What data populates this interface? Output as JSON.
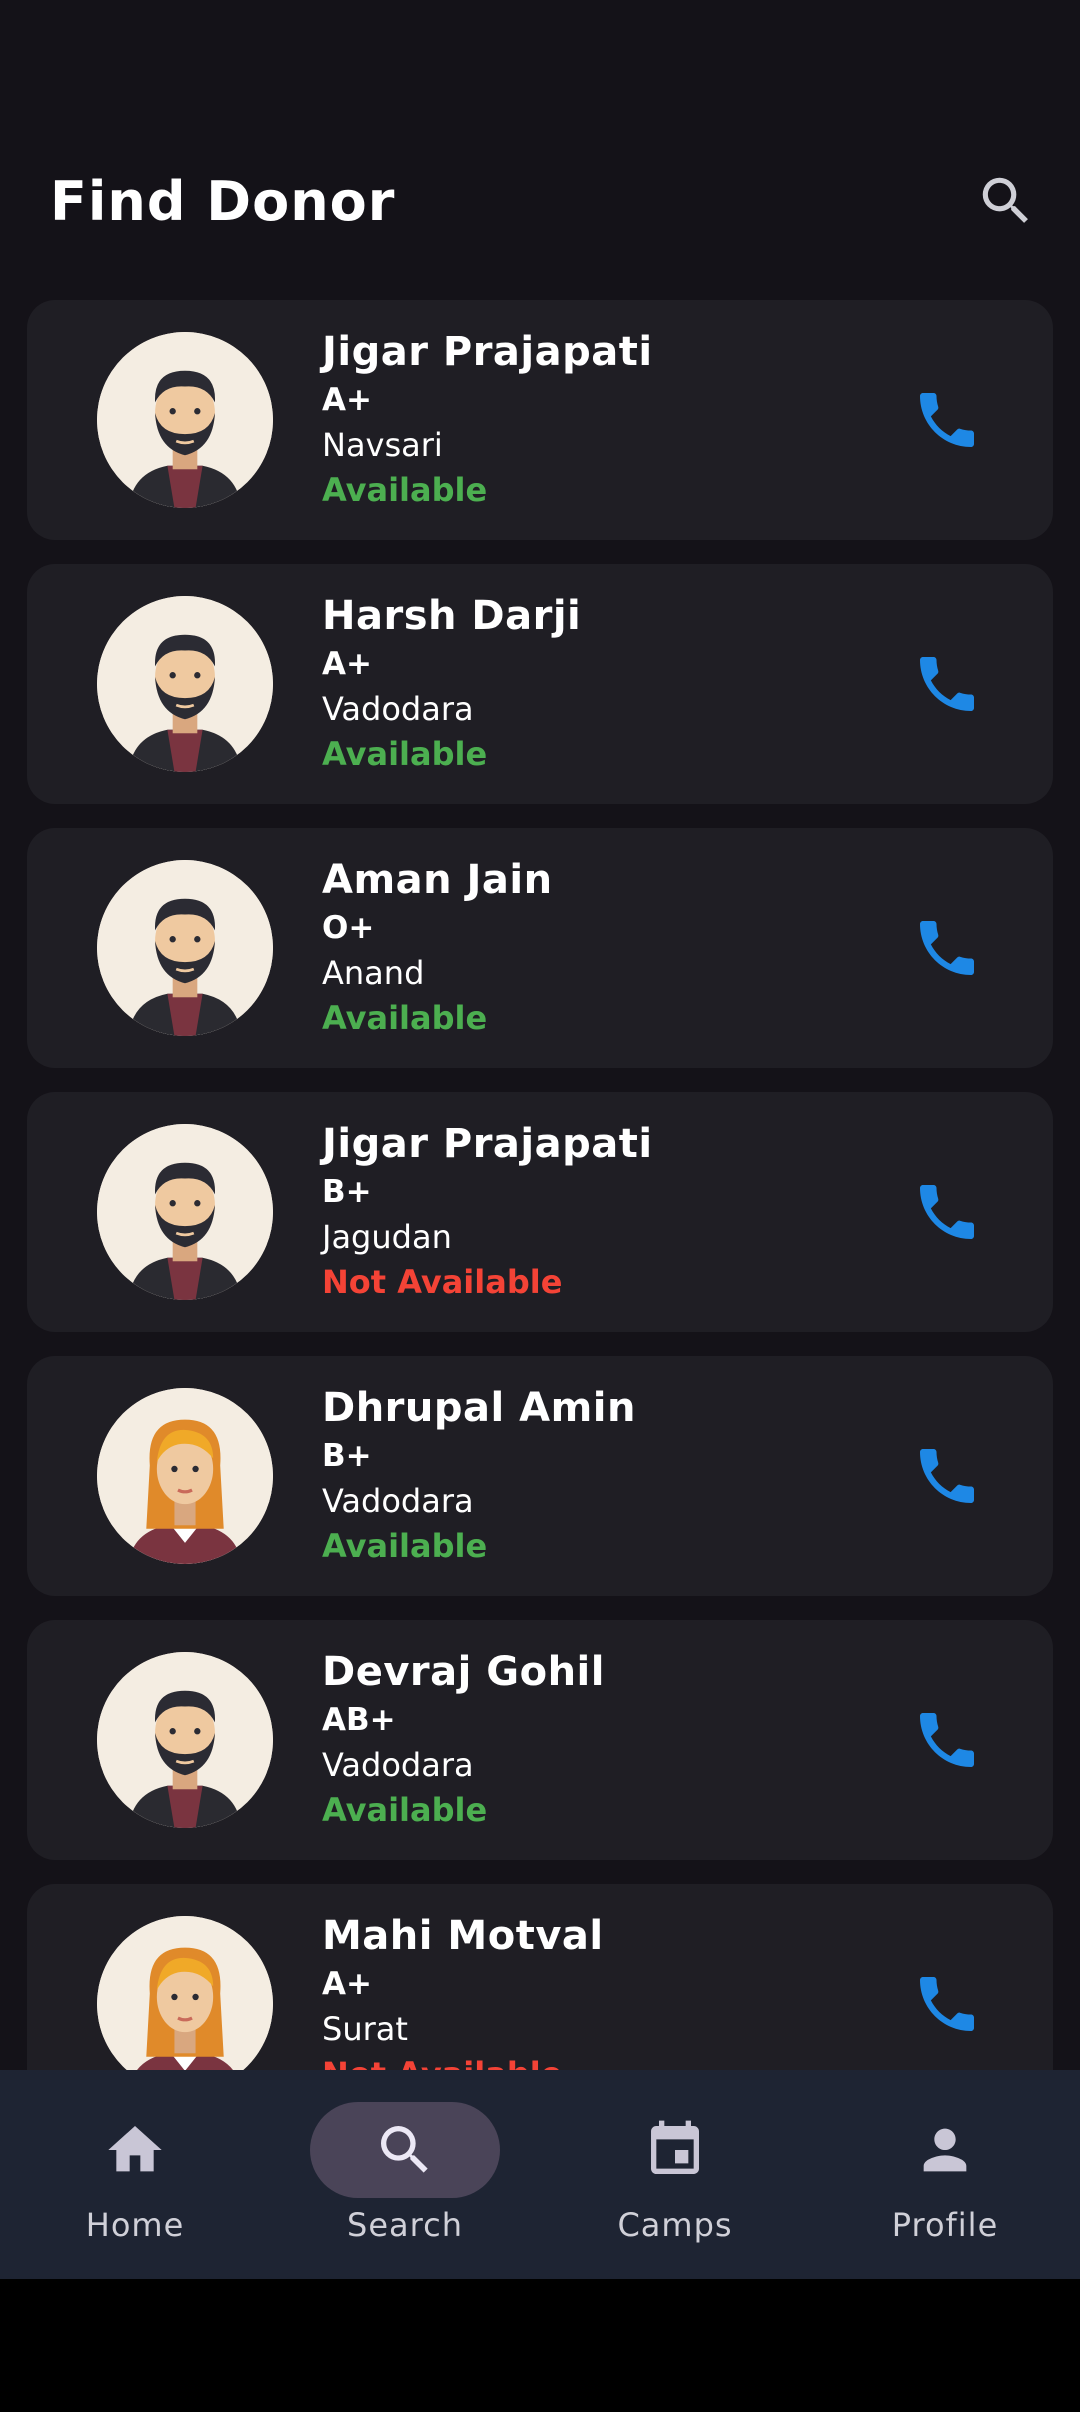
{
  "header": {
    "title": "Find Donor"
  },
  "colors": {
    "available": "#4caf50",
    "not_available": "#f44336",
    "call": "#1e88e5",
    "card": "#1f1e24",
    "nav_bg": "#1e2433"
  },
  "donors": [
    {
      "name": "Jigar Prajapati",
      "blood_group": "A+",
      "city": "Navsari",
      "status": "Available",
      "avatar": "male-avatar-icon"
    },
    {
      "name": "Harsh Darji",
      "blood_group": "A+",
      "city": "Vadodara",
      "status": "Available",
      "avatar": "male-avatar-icon"
    },
    {
      "name": "Aman Jain",
      "blood_group": "O+",
      "city": "Anand",
      "status": "Available",
      "avatar": "male-avatar-icon"
    },
    {
      "name": "Jigar Prajapati",
      "blood_group": "B+",
      "city": "Jagudan",
      "status": "Not Available",
      "avatar": "male-avatar-icon"
    },
    {
      "name": "Dhrupal Amin",
      "blood_group": "B+",
      "city": "Vadodara",
      "status": "Available",
      "avatar": "female-avatar-icon"
    },
    {
      "name": "Devraj Gohil",
      "blood_group": "AB+",
      "city": "Vadodara",
      "status": "Available",
      "avatar": "male-avatar-icon"
    },
    {
      "name": "Mahi Motval",
      "blood_group": "A+",
      "city": "Surat",
      "status": "Not Available",
      "avatar": "female-avatar-icon"
    }
  ],
  "nav": {
    "items": [
      {
        "label": "Home",
        "icon": "home-icon"
      },
      {
        "label": "Search",
        "icon": "search-icon",
        "active": true
      },
      {
        "label": "Camps",
        "icon": "calendar-icon"
      },
      {
        "label": "Profile",
        "icon": "person-icon"
      }
    ]
  }
}
